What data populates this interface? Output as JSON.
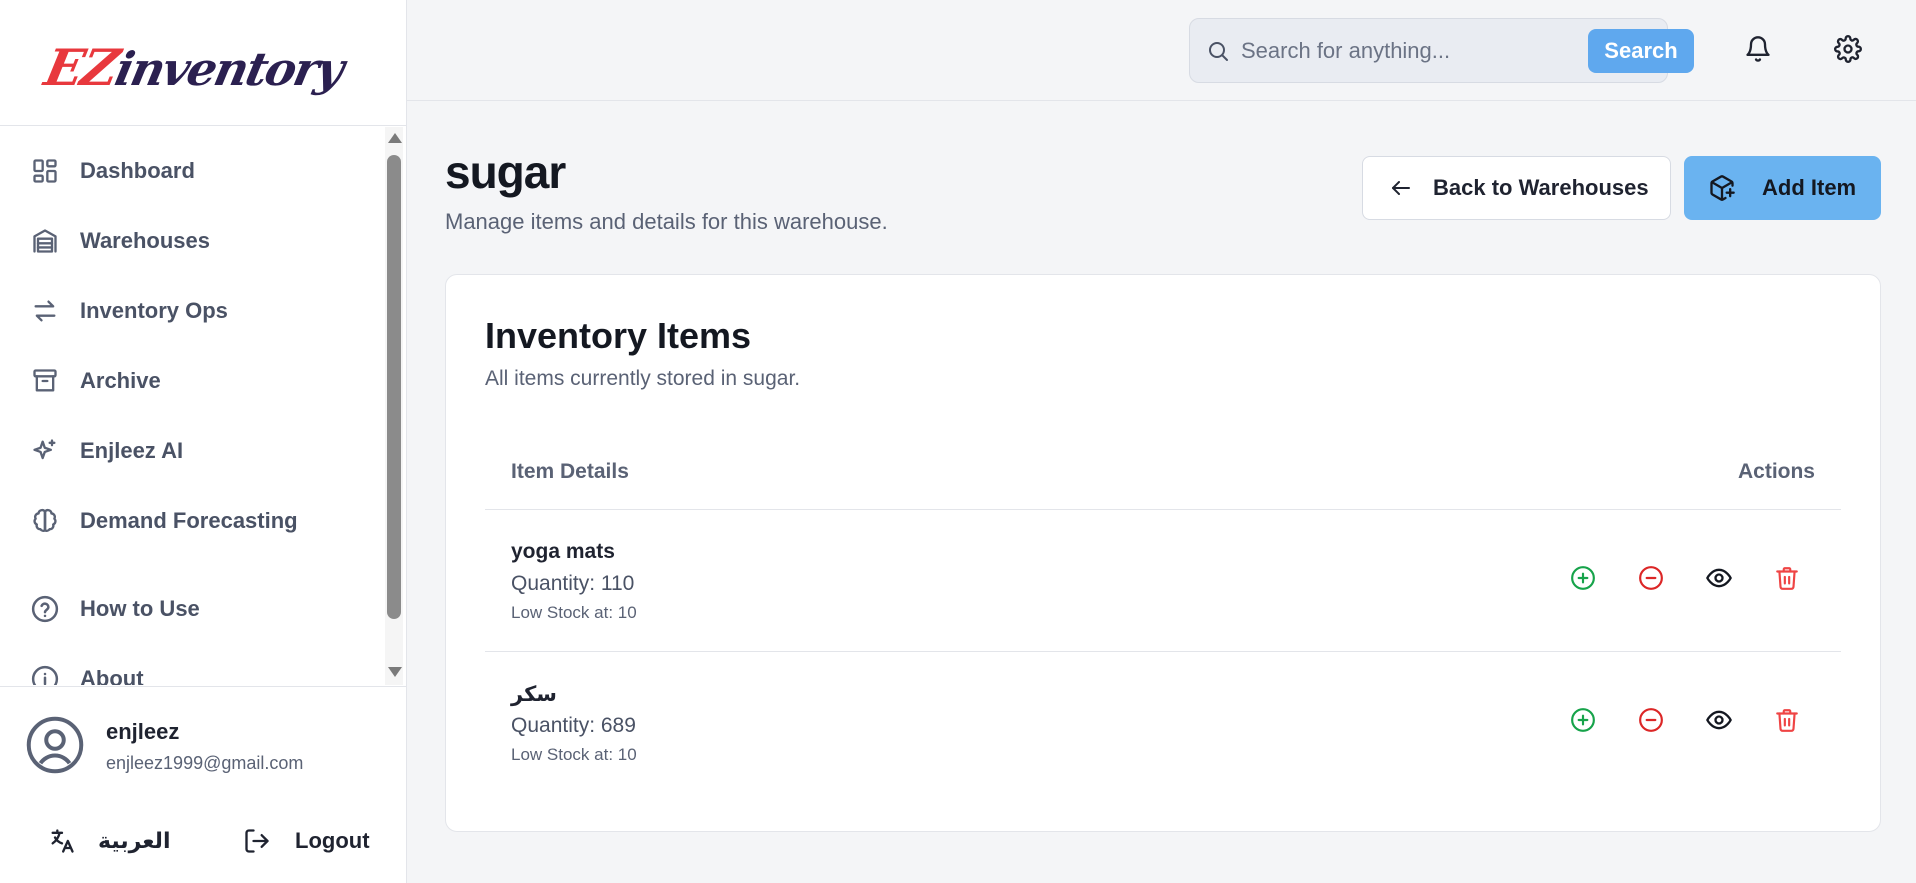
{
  "brand": {
    "logo_ez": "EZ",
    "logo_rest": "inventory"
  },
  "sidebar": {
    "items": [
      {
        "label": "Dashboard",
        "icon": "dashboard-icon"
      },
      {
        "label": "Warehouses",
        "icon": "warehouse-icon"
      },
      {
        "label": "Inventory Ops",
        "icon": "arrows-exchange-icon"
      },
      {
        "label": "Archive",
        "icon": "archive-icon"
      },
      {
        "label": "Enjleez AI",
        "icon": "sparkles-icon"
      },
      {
        "label": "Demand Forecasting",
        "icon": "brain-icon"
      },
      {
        "label": "How to Use",
        "icon": "help-circle-icon"
      },
      {
        "label": "About",
        "icon": "info-icon"
      }
    ]
  },
  "user": {
    "name": "enjleez",
    "email": "enjleez1999@gmail.com",
    "language_label": "العربية",
    "logout_label": "Logout"
  },
  "header": {
    "search_placeholder": "Search for anything...",
    "search_button": "Search"
  },
  "page": {
    "title": "sugar",
    "subtitle": "Manage items and details for this warehouse.",
    "back_button": "Back to Warehouses",
    "add_button": "Add Item"
  },
  "card": {
    "title": "Inventory Items",
    "description": "All items currently stored in sugar.",
    "columns": {
      "details": "Item Details",
      "actions": "Actions"
    },
    "items": [
      {
        "name": "yoga mats",
        "quantity": "Quantity: 110",
        "low_stock": "Low Stock at: 10"
      },
      {
        "name": "سكر",
        "quantity": "Quantity: 689",
        "low_stock": "Low Stock at: 10"
      }
    ]
  },
  "colors": {
    "accent": "#5fa8ee",
    "add_button": "#6ab3f0",
    "increase": "#16a34a",
    "decrease": "#dc2626",
    "delete": "#ef4444"
  }
}
